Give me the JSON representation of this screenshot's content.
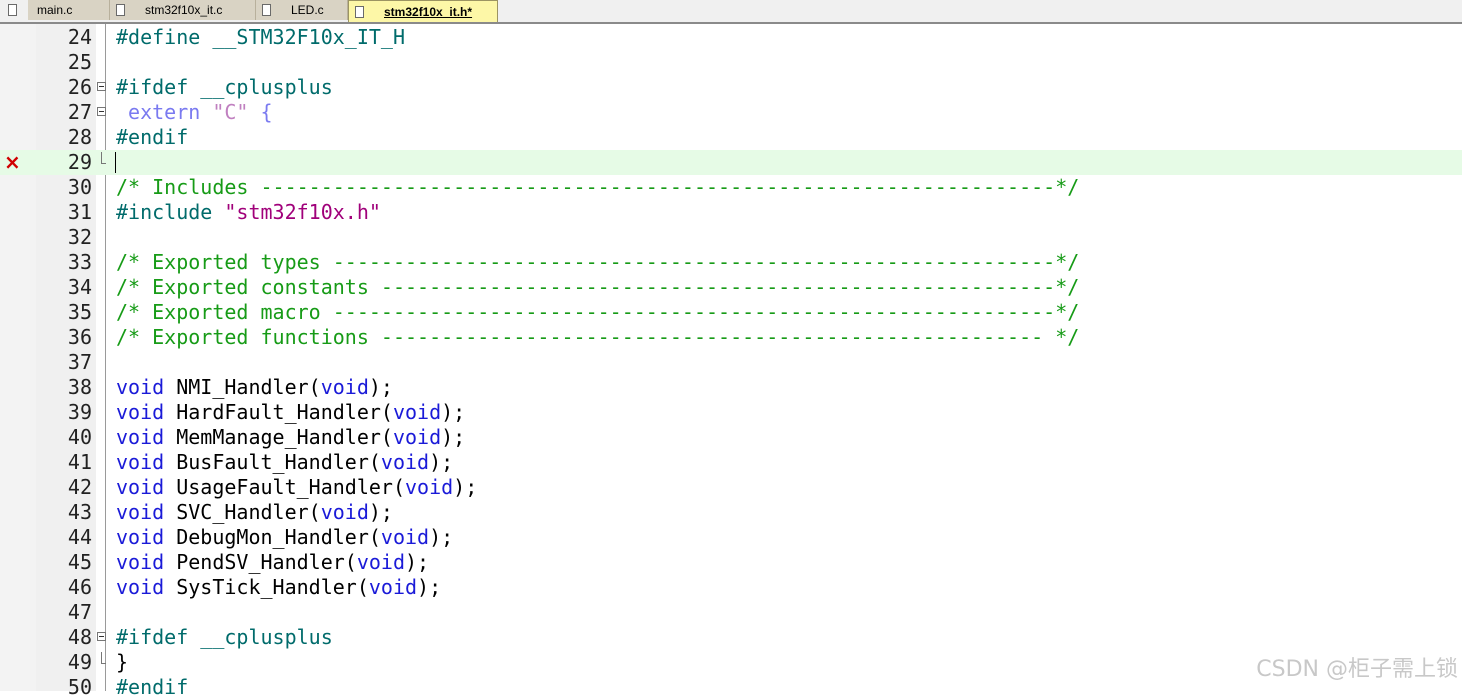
{
  "tabs": [
    {
      "label": "main.c",
      "active": false
    },
    {
      "label": "stm32f10x_it.c",
      "active": false
    },
    {
      "label": "LED.c",
      "active": false
    },
    {
      "label": "stm32f10x_it.h*",
      "active": true
    }
  ],
  "editor": {
    "current_line": 29,
    "lines": [
      {
        "num": "24",
        "text": "#define __STM32F10x_IT_H"
      },
      {
        "num": "25",
        "text": ""
      },
      {
        "num": "26",
        "text": "#ifdef __cplusplus"
      },
      {
        "num": "27",
        "text": " extern \"C\" {"
      },
      {
        "num": "28",
        "text": "#endif"
      },
      {
        "num": "29",
        "text": ""
      },
      {
        "num": "30",
        "text": "/* Includes ------------------------------------------------------------------*/"
      },
      {
        "num": "31",
        "text": "#include \"stm32f10x.h\""
      },
      {
        "num": "32",
        "text": ""
      },
      {
        "num": "33",
        "text": "/* Exported types ------------------------------------------------------------*/"
      },
      {
        "num": "34",
        "text": "/* Exported constants --------------------------------------------------------*/"
      },
      {
        "num": "35",
        "text": "/* Exported macro ------------------------------------------------------------*/"
      },
      {
        "num": "36",
        "text": "/* Exported functions ------------------------------------------------------- */"
      },
      {
        "num": "37",
        "text": ""
      },
      {
        "num": "38",
        "kw": "void",
        "name": "NMI_Handler(",
        "param": "void",
        "tail": ");"
      },
      {
        "num": "39",
        "kw": "void",
        "name": "HardFault_Handler(",
        "param": "void",
        "tail": ");"
      },
      {
        "num": "40",
        "kw": "void",
        "name": "MemManage_Handler(",
        "param": "void",
        "tail": ");"
      },
      {
        "num": "41",
        "kw": "void",
        "name": "BusFault_Handler(",
        "param": "void",
        "tail": ");"
      },
      {
        "num": "42",
        "kw": "void",
        "name": "UsageFault_Handler(",
        "param": "void",
        "tail": ");"
      },
      {
        "num": "43",
        "kw": "void",
        "name": "SVC_Handler(",
        "param": "void",
        "tail": ");"
      },
      {
        "num": "44",
        "kw": "void",
        "name": "DebugMon_Handler(",
        "param": "void",
        "tail": ");"
      },
      {
        "num": "45",
        "kw": "void",
        "name": "PendSV_Handler(",
        "param": "void",
        "tail": ");"
      },
      {
        "num": "46",
        "kw": "void",
        "name": "SysTick_Handler(",
        "param": "void",
        "tail": ");"
      },
      {
        "num": "47",
        "text": ""
      },
      {
        "num": "48",
        "text": "#ifdef __cplusplus"
      },
      {
        "num": "49",
        "text": "}"
      },
      {
        "num": "50",
        "text": "#endif"
      }
    ],
    "error_marker": "×",
    "syntax_colors": {
      "preprocessor": "#006b6b",
      "comment": "#179b17",
      "string": "#a0007a",
      "keyword": "#1a1ad8",
      "current_line_bg": "#e6fbe6",
      "error": "#d00000"
    }
  },
  "watermark": "CSDN @柜子需上锁"
}
